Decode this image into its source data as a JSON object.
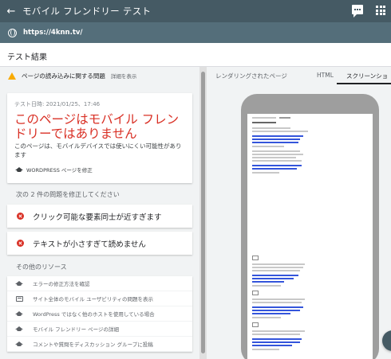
{
  "topbar": {
    "back_glyph": "←",
    "title": "モバイル フレンドリー テスト"
  },
  "urlbar": {
    "url": "https://4knn.tv/"
  },
  "result_title": "テスト結果",
  "warning": {
    "text": "ページの読み込みに関する問題",
    "detail_link": "詳細を表示"
  },
  "card": {
    "date": "テスト日時: 2021/01/25、17:46",
    "headline": "このページはモバイル フレンドリーではありません",
    "subtext": "このページは、モバイルデバイスでは使いにくい可能性があります",
    "fix_link": "WORDPRESS ページを修正"
  },
  "issues_title": "次の 2 件の問題を修正してください",
  "issues": [
    {
      "text": "クリック可能な要素同士が近すぎます"
    },
    {
      "text": "テキストが小さすぎて読めません"
    }
  ],
  "resources_title": "その他のリソース",
  "resources": [
    {
      "icon": "graduation-cap-icon",
      "text": "エラーの修正方法を確認"
    },
    {
      "icon": "report-icon",
      "text": "サイト全体のモバイル ユーザビリティの問題を表示"
    },
    {
      "icon": "graduation-cap-icon",
      "text": "WordPress ではなく他のホストを使用している場合"
    },
    {
      "icon": "graduation-cap-icon",
      "text": "モバイル フレンドリー ページの詳細"
    },
    {
      "icon": "graduation-cap-icon",
      "text": "コメントや質問をディスカッション グループに投稿"
    }
  ],
  "tabs": {
    "rendered": "レンダリングされたページ",
    "html": "HTML",
    "screenshot": "スクリーンショ"
  },
  "colors": {
    "header": "#455a64",
    "urlbar": "#546e7a",
    "error_red": "#d93025",
    "warning": "#f9ab00"
  }
}
